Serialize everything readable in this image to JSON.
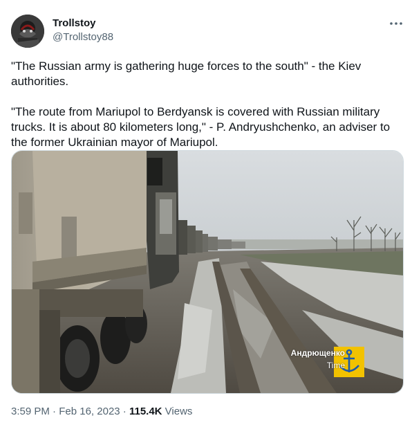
{
  "author": {
    "name": "Trollstoy",
    "handle": "@Trollstoy88"
  },
  "tweet": {
    "paragraph_1": "\"The Russian army is gathering huge forces to the south\" - the Kiev\nauthorities.",
    "paragraph_2": "\"The route from Mariupol to Berdyansk is covered with Russian military\ntrucks. It is about 80 kilometers long,\" - P. Andryushchenko, an adviser to\nthe former Ukrainian mayor of Mariupol."
  },
  "media": {
    "watermark_name": "Андрющенко",
    "watermark_sub": "Time",
    "logo_color": "#f2c200",
    "logo_anchor_color": "#1e5aa8"
  },
  "meta": {
    "time": "3:59 PM",
    "separator_1": " · ",
    "date": "Feb 16, 2023",
    "separator_2": " · ",
    "views_count": "115.4K",
    "views_label": " Views"
  },
  "icons": {
    "more": "more-horizontal-icon"
  }
}
